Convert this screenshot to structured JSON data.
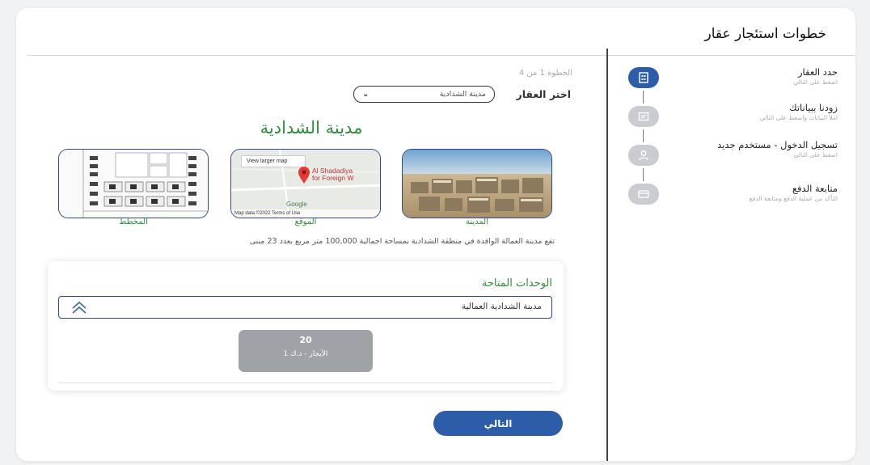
{
  "header": {
    "title": "خطوات استئجار عقار"
  },
  "steps": [
    {
      "title": "حدد العقار",
      "subtitle": "اضغط على التالي",
      "icon": "building-icon",
      "active": true
    },
    {
      "title": "زودنا ببياناتك",
      "subtitle": "املأ البيانات واضغط على التالي",
      "icon": "form-icon",
      "active": false
    },
    {
      "title": "تسجيل الدخول - مستخدم جديد",
      "subtitle": "اضغط على التالي",
      "icon": "user-icon",
      "active": false
    },
    {
      "title": "متابعة الدفع",
      "subtitle": "التأكد من عملية الدفع ومتابعة الدفع",
      "icon": "payment-icon",
      "active": false
    }
  ],
  "main": {
    "step_counter": "الخطوة 1 من 4",
    "select_label": "اختر العقار",
    "select_value": "مدينة الشدادية",
    "city_name": "مدينة الشدادية",
    "thumbnails": {
      "city_label": "المدينة",
      "map_label": "الموقع",
      "plan_label": "المخطط"
    },
    "map": {
      "view_larger": "View larger map",
      "place_line1": "Al Shadadiya",
      "place_line2": "for Foreign W",
      "google": "Google",
      "footer": "Map data ©2022   Terms of Use"
    },
    "description": "تقع مدينة العمالة الوافدة في منطقة الشدادية بمساحة اجمالية 100,000 متر مربع بعدد 23 مبنى",
    "units": {
      "title": "الوحدات المتاحة",
      "group_label": "مدينة الشدادية العمالية",
      "unit_count": "20",
      "unit_price": "الأيجار - د.ك 1"
    },
    "next_button": "التالي"
  },
  "colors": {
    "primary": "#2d5da8",
    "green": "#2f8d3a",
    "border_blue": "#2c4a8a",
    "unit_gray": "#9fa3a8"
  }
}
